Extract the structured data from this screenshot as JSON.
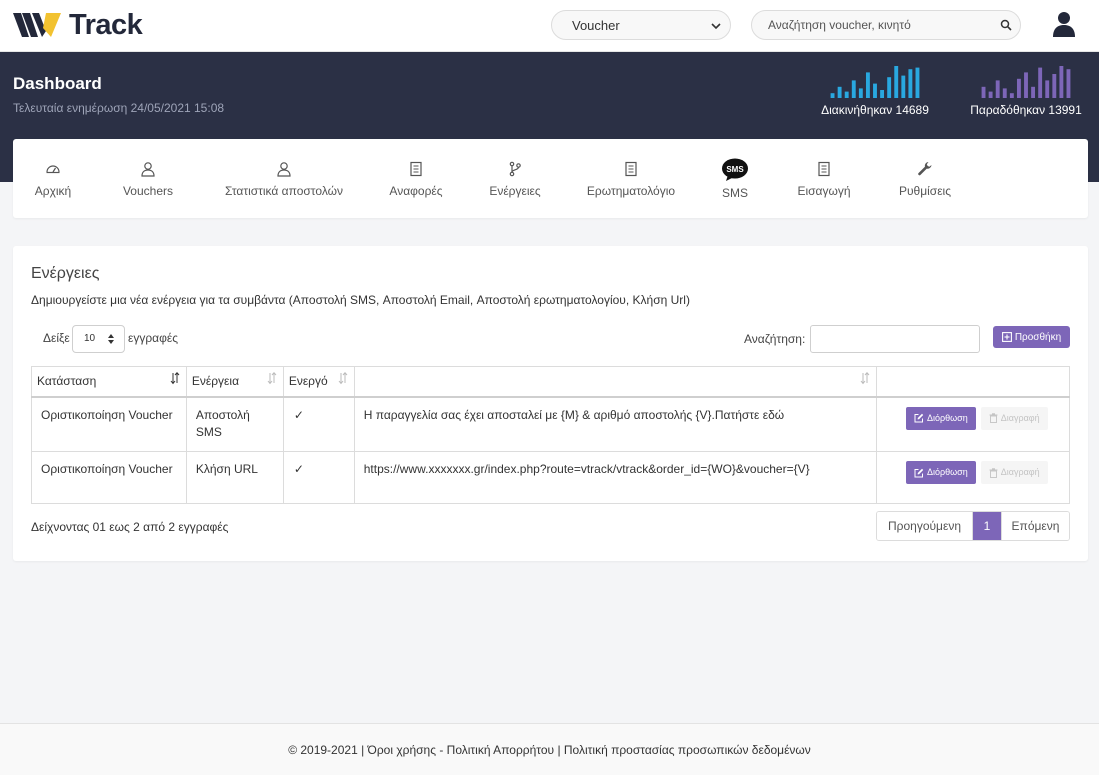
{
  "header": {
    "logo_text": "Track",
    "type_select": {
      "value": "Voucher"
    },
    "search": {
      "placeholder": "Αναζήτηση voucher, κινητό"
    }
  },
  "dashboard": {
    "title": "Dashboard",
    "subtitle": "Τελευταία ενημέρωση 24/05/2021 15:08",
    "stats": [
      {
        "label": "Διακινήθηκαν 14689",
        "color": "#29a8e0",
        "levels": [
          0.15,
          0.35,
          0.2,
          0.55,
          0.3,
          0.8,
          0.45,
          0.25,
          0.65,
          1.0,
          0.7,
          0.9,
          0.95
        ]
      },
      {
        "label": "Παραδόθηκαν 13991",
        "color": "#7d66b8",
        "levels": [
          0.35,
          0.2,
          0.55,
          0.3,
          0.15,
          0.6,
          0.8,
          0.35,
          0.95,
          0.55,
          0.75,
          1.0,
          0.9
        ]
      }
    ]
  },
  "nav": {
    "items": [
      {
        "label": "Αρχική",
        "icon": "dashboard-icon"
      },
      {
        "label": "Vouchers",
        "icon": "user-icon"
      },
      {
        "label": "Στατιστικά αποστολών",
        "icon": "user-icon"
      },
      {
        "label": "Αναφορές",
        "icon": "receipt-icon"
      },
      {
        "label": "Ενέργειες",
        "icon": "branch-icon"
      },
      {
        "label": "Ερωτηματολόγιο",
        "icon": "receipt-icon"
      },
      {
        "label": "SMS",
        "icon": "sms-bubble-icon",
        "badge": "SMS"
      },
      {
        "label": "Εισαγωγή",
        "icon": "receipt-icon"
      },
      {
        "label": "Ρυθμίσεις",
        "icon": "wrench-icon"
      }
    ]
  },
  "main": {
    "title": "Ενέργειες",
    "description": "Δημιουργείστε μια νέα ενέργεια για τα συμβάντα (Αποστολή SMS, Αποστολή Email, Αποστολή ερωτηματολογίου, Κλήση Url)",
    "length": {
      "before": "Δείξε",
      "value": "10",
      "after": "εγγραφές"
    },
    "search_label": "Αναζήτηση:",
    "add_label": "Προσθήκη",
    "table": {
      "columns": [
        "Κατάσταση",
        "Ενέργεια",
        "Ενεργό",
        "",
        ""
      ],
      "rows": [
        {
          "status": "Οριστικοποίηση Voucher",
          "action": "Αποστολή SMS",
          "active": "✓",
          "content": "Η παραγγελία σας έχει αποσταλεί με {M} & αριθμό αποστολής {V}.Πατήστε εδώ",
          "edit": "Διόρθωση",
          "delete": "Διαγραφή"
        },
        {
          "status": "Οριστικοποίηση Voucher",
          "action": "Κλήση URL",
          "active": "✓",
          "content": "https://www.xxxxxxx.gr/index.php?route=vtrack/vtrack&order_id={WO}&voucher={V}",
          "edit": "Διόρθωση",
          "delete": "Διαγραφή"
        }
      ]
    },
    "info": "Δείχνοντας 01 εως 2 από 2 εγγραφές",
    "pagination": {
      "prev": "Προηγούμενη",
      "current": "1",
      "next": "Επόμενη"
    }
  },
  "footer": {
    "text": "© 2019-2021 | Όροι χρήσης - Πολιτική Απορρήτου | Πολιτική προστασίας προσωπικών δεδομένων"
  }
}
